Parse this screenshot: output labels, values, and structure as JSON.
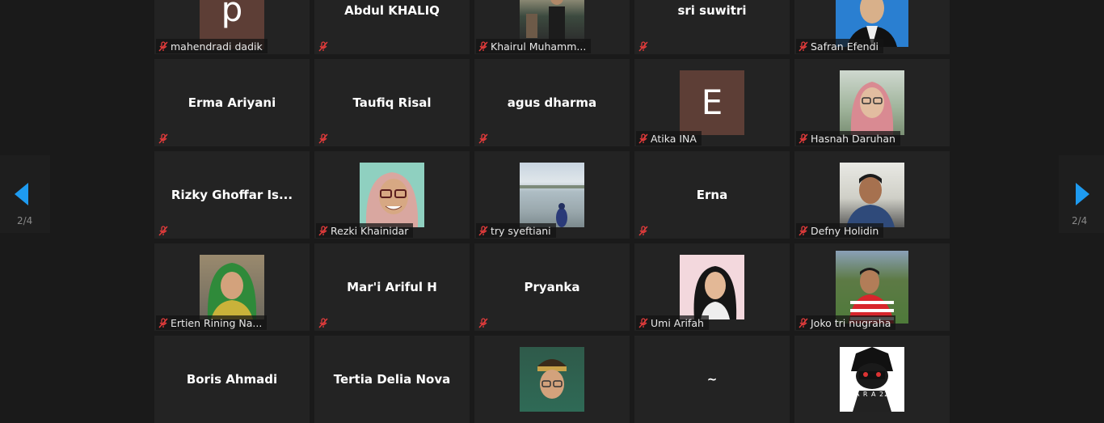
{
  "pagination": {
    "left_label": "2/4",
    "right_label": "2/4"
  },
  "colors": {
    "accent": "#1e9bf0",
    "mute_red": "#e23b3b",
    "tile_bg": "#232323",
    "avatar_letter_bg": "#5d3e36"
  },
  "participants": [
    {
      "name": "mahendradi dadik",
      "avatar": "letter",
      "letter": "p"
    },
    {
      "name": "Abdul KHALIQ",
      "avatar": "none"
    },
    {
      "name": "Khairul Muhamm...",
      "avatar": "photo"
    },
    {
      "name": "sri suwitri",
      "avatar": "none"
    },
    {
      "name": "Safran Efendi",
      "avatar": "photo"
    },
    {
      "name": "Erma Ariyani",
      "avatar": "none"
    },
    {
      "name": "Taufiq Risal",
      "avatar": "none"
    },
    {
      "name": "agus dharma",
      "avatar": "none"
    },
    {
      "name": "Atika INA",
      "avatar": "letter",
      "letter": "E"
    },
    {
      "name": "Hasnah Daruhan",
      "avatar": "photo"
    },
    {
      "name": "Rizky Ghoffar Is...",
      "avatar": "none"
    },
    {
      "name": "Rezki Khainidar",
      "avatar": "photo"
    },
    {
      "name": "try syeftiani",
      "avatar": "photo"
    },
    {
      "name": "Erna",
      "avatar": "none"
    },
    {
      "name": "Defny Holidin",
      "avatar": "photo"
    },
    {
      "name": "Ertien Rining Na...",
      "avatar": "photo"
    },
    {
      "name": "Mar'i Ariful H",
      "avatar": "none"
    },
    {
      "name": "Pryanka",
      "avatar": "none"
    },
    {
      "name": "Umi Arifah",
      "avatar": "photo"
    },
    {
      "name": "Joko tri nugraha",
      "avatar": "photo"
    },
    {
      "name": "Boris Ahmadi",
      "avatar": "none"
    },
    {
      "name": "Tertia Delia Nova",
      "avatar": "none"
    },
    {
      "name": "",
      "avatar": "photo"
    },
    {
      "name": "~",
      "avatar": "none"
    },
    {
      "name": "",
      "avatar": "photo",
      "badge_text": "A R A 22"
    }
  ]
}
